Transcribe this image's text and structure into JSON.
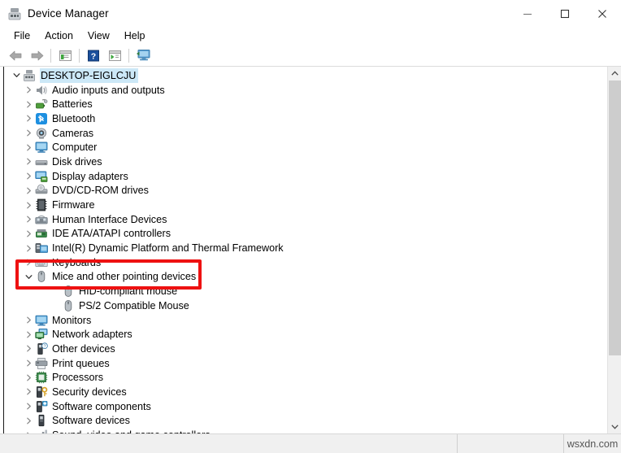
{
  "window": {
    "title": "Device Manager",
    "title_icon": "device-manager-icon",
    "controls": {
      "minimize": "minimize-icon",
      "maximize": "maximize-icon",
      "close": "close-icon"
    }
  },
  "menubar": {
    "items": [
      {
        "label": "File"
      },
      {
        "label": "Action"
      },
      {
        "label": "View"
      },
      {
        "label": "Help"
      }
    ]
  },
  "toolbar": {
    "buttons": [
      {
        "name": "back-arrow-icon",
        "kind": "back"
      },
      {
        "name": "forward-arrow-icon",
        "kind": "forward"
      },
      {
        "name": "separator-1",
        "kind": "sep"
      },
      {
        "name": "properties-icon",
        "kind": "props"
      },
      {
        "name": "separator-2",
        "kind": "sep"
      },
      {
        "name": "help-icon",
        "kind": "help"
      },
      {
        "name": "update-driver-icon",
        "kind": "update"
      },
      {
        "name": "separator-3",
        "kind": "sep"
      },
      {
        "name": "scan-hardware-changes-icon",
        "kind": "scan"
      }
    ]
  },
  "tree": {
    "root": {
      "label": "DESKTOP-EIGLCJU",
      "icon": "computer-root-icon",
      "expanded": true,
      "selected": true
    },
    "nodes": [
      {
        "label": "Audio inputs and outputs",
        "icon": "speaker-icon",
        "expanded": false,
        "level": 1
      },
      {
        "label": "Batteries",
        "icon": "battery-icon",
        "expanded": false,
        "level": 1
      },
      {
        "label": "Bluetooth",
        "icon": "bluetooth-icon",
        "expanded": false,
        "level": 1
      },
      {
        "label": "Cameras",
        "icon": "camera-icon",
        "expanded": false,
        "level": 1
      },
      {
        "label": "Computer",
        "icon": "computer-icon",
        "expanded": false,
        "level": 1
      },
      {
        "label": "Disk drives",
        "icon": "disk-drive-icon",
        "expanded": false,
        "level": 1
      },
      {
        "label": "Display adapters",
        "icon": "display-adapter-icon",
        "expanded": false,
        "level": 1
      },
      {
        "label": "DVD/CD-ROM drives",
        "icon": "dvd-drive-icon",
        "expanded": false,
        "level": 1
      },
      {
        "label": "Firmware",
        "icon": "firmware-icon",
        "expanded": false,
        "level": 1
      },
      {
        "label": "Human Interface Devices",
        "icon": "hid-icon",
        "expanded": false,
        "level": 1
      },
      {
        "label": "IDE ATA/ATAPI controllers",
        "icon": "ide-controller-icon",
        "expanded": false,
        "level": 1
      },
      {
        "label": "Intel(R) Dynamic Platform and Thermal Framework",
        "icon": "thermal-framework-icon",
        "expanded": false,
        "level": 1
      },
      {
        "label": "Keyboards",
        "icon": "keyboard-icon",
        "expanded": false,
        "level": 1
      },
      {
        "label": "Mice and other pointing devices",
        "icon": "mouse-icon",
        "expanded": true,
        "level": 1
      },
      {
        "label": "HID-compliant mouse",
        "icon": "mouse-device-icon",
        "expanded": null,
        "level": 2
      },
      {
        "label": "PS/2 Compatible Mouse",
        "icon": "mouse-device-icon",
        "expanded": null,
        "level": 2
      },
      {
        "label": "Monitors",
        "icon": "monitor-icon",
        "expanded": false,
        "level": 1
      },
      {
        "label": "Network adapters",
        "icon": "network-adapter-icon",
        "expanded": false,
        "level": 1
      },
      {
        "label": "Other devices",
        "icon": "other-device-icon",
        "expanded": false,
        "level": 1
      },
      {
        "label": "Print queues",
        "icon": "printer-icon",
        "expanded": false,
        "level": 1
      },
      {
        "label": "Processors",
        "icon": "processor-icon",
        "expanded": false,
        "level": 1
      },
      {
        "label": "Security devices",
        "icon": "security-device-icon",
        "expanded": false,
        "level": 1
      },
      {
        "label": "Software components",
        "icon": "software-component-icon",
        "expanded": false,
        "level": 1
      },
      {
        "label": "Software devices",
        "icon": "software-device-icon",
        "expanded": false,
        "level": 1
      },
      {
        "label": "Sound, video and game controllers",
        "icon": "sound-controller-icon",
        "expanded": false,
        "level": 1
      }
    ]
  },
  "scrollbar": {
    "up_arrow": "scroll-up-icon",
    "down_arrow": "scroll-down-icon",
    "thumb_fraction": 0.81
  },
  "annotation": {
    "color": "#ee1111",
    "target_label": "Mice and other pointing devices"
  },
  "statusbar": {
    "watermark": "wsxdn.com"
  },
  "colors": {
    "selection": "#cce8f7",
    "annotation_red": "#ee1111",
    "chrome": "#f0f0f0"
  }
}
